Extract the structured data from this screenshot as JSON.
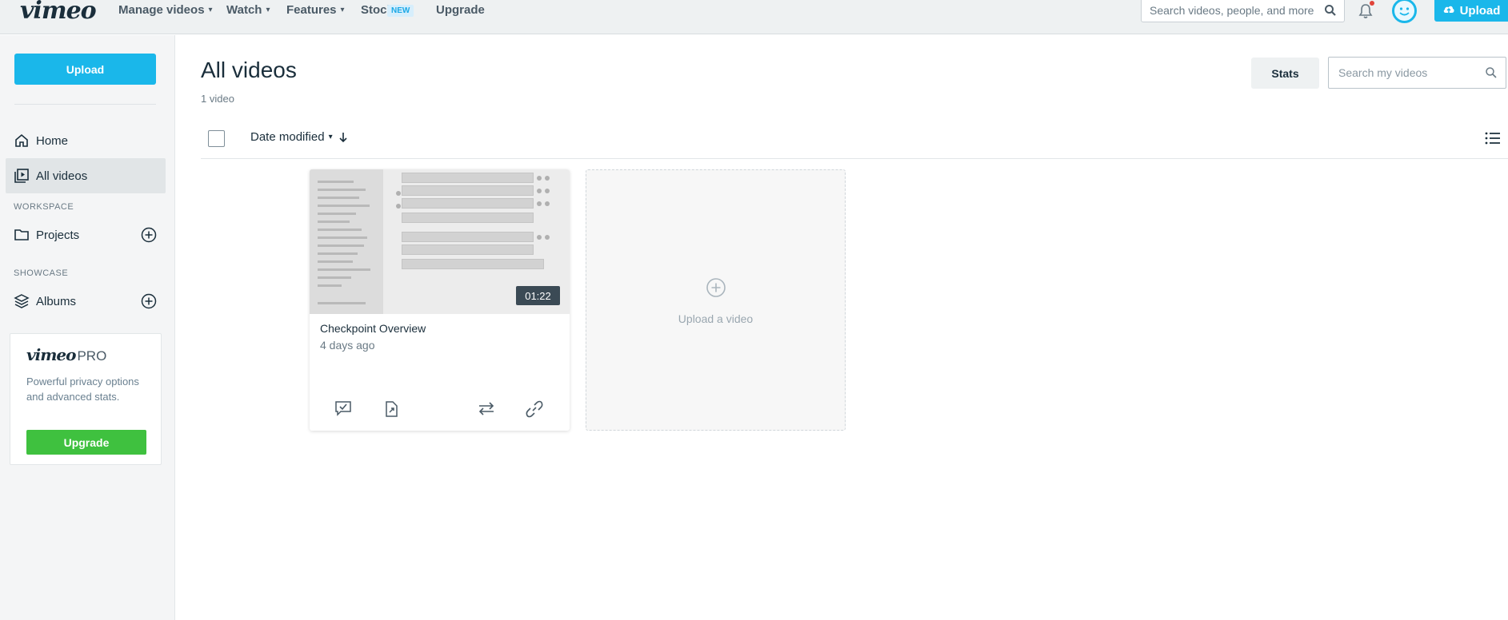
{
  "topnav": {
    "logo": "vimeo",
    "items": [
      {
        "label": "Manage videos"
      },
      {
        "label": "Watch"
      },
      {
        "label": "Features"
      },
      {
        "label": "Stock"
      },
      {
        "label": "Upgrade"
      }
    ],
    "stock_badge": "NEW",
    "search_placeholder": "Search videos, people, and more",
    "upload_label": "Upload"
  },
  "sidebar": {
    "upload_label": "Upload",
    "home": "Home",
    "all_videos": "All videos",
    "workspace_label": "WORKSPACE",
    "projects": "Projects",
    "showcase_label": "SHOWCASE",
    "albums": "Albums",
    "pro": {
      "logo_main": "vimeo",
      "logo_suffix": "PRO",
      "text": "Powerful privacy options and advanced stats.",
      "upgrade_label": "Upgrade"
    }
  },
  "main": {
    "title": "All videos",
    "count": "1 video",
    "stats_label": "Stats",
    "search_placeholder": "Search my videos",
    "sort_label": "Date modified",
    "videos": [
      {
        "title": "Checkpoint Overview",
        "time": "4 days ago",
        "duration": "01:22"
      }
    ],
    "upload_card_label": "Upload a video"
  },
  "colors": {
    "accent": "#1ab7ea",
    "upgrade_green": "#3fc13f"
  }
}
